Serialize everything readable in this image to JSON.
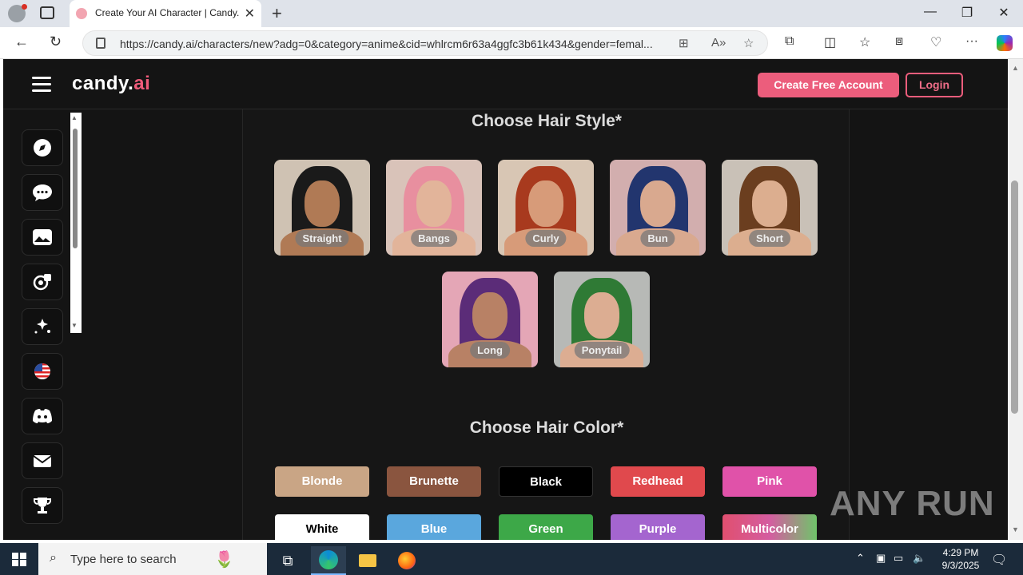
{
  "browser": {
    "tab_title": "Create Your AI Character | Candy.ai",
    "url": "https://candy.ai/characters/new?adg=0&category=anime&cid=whlrcm6r63a4ggfc3b61k434&gender=femal..."
  },
  "header": {
    "logo_main": "candy.",
    "logo_accent": "ai",
    "create_account": "Create Free Account",
    "login": "Login"
  },
  "sidebar": {
    "items": [
      {
        "icon": "compass-icon"
      },
      {
        "icon": "chat-icon"
      },
      {
        "icon": "gallery-icon"
      },
      {
        "icon": "create-character-icon"
      },
      {
        "icon": "generate-image-icon"
      },
      {
        "icon": "us-flag-icon"
      },
      {
        "icon": "discord-icon"
      },
      {
        "icon": "mail-icon"
      },
      {
        "icon": "trophy-icon"
      }
    ]
  },
  "hair_style": {
    "title": "Choose Hair Style*",
    "options": [
      {
        "label": "Straight",
        "hair": "#1a1a1a",
        "bg": "#cfc2b3",
        "skin": "#b07a55"
      },
      {
        "label": "Bangs",
        "hair": "#e88f9f",
        "bg": "#d9c3b9",
        "skin": "#e2b49a"
      },
      {
        "label": "Curly",
        "hair": "#a83a1e",
        "bg": "#d8c6b4",
        "skin": "#d79b79"
      },
      {
        "label": "Bun",
        "hair": "#22356e",
        "bg": "#d2aeae",
        "skin": "#d9a98f"
      },
      {
        "label": "Short",
        "hair": "#6b3e1f",
        "bg": "#c9c1b7",
        "skin": "#dcae8f"
      },
      {
        "label": "Long",
        "hair": "#5b2c78",
        "bg": "#e4a6b6",
        "skin": "#b88165"
      },
      {
        "label": "Ponytail",
        "hair": "#2f7a35",
        "bg": "#b7b9b6",
        "skin": "#dcad92"
      }
    ]
  },
  "hair_color": {
    "title": "Choose Hair Color*",
    "options": [
      {
        "label": "Blonde",
        "color": "#c9a585"
      },
      {
        "label": "Brunette",
        "color": "#8a553f"
      },
      {
        "label": "Black",
        "color": "#000000"
      },
      {
        "label": "Redhead",
        "color": "#e0494d"
      },
      {
        "label": "Pink",
        "color": "#e052a9"
      },
      {
        "label": "White",
        "color": "#ffffff"
      },
      {
        "label": "Blue",
        "color": "#5aa7dd"
      },
      {
        "label": "Green",
        "color": "#3da848"
      },
      {
        "label": "Purple",
        "color": "#a465cf"
      },
      {
        "label": "Multicolor",
        "color": "#e04f6f"
      }
    ]
  },
  "watermark": "ANY RUN",
  "taskbar": {
    "search_placeholder": "Type here to search",
    "time": "4:29 PM",
    "date": "9/3/2025"
  }
}
